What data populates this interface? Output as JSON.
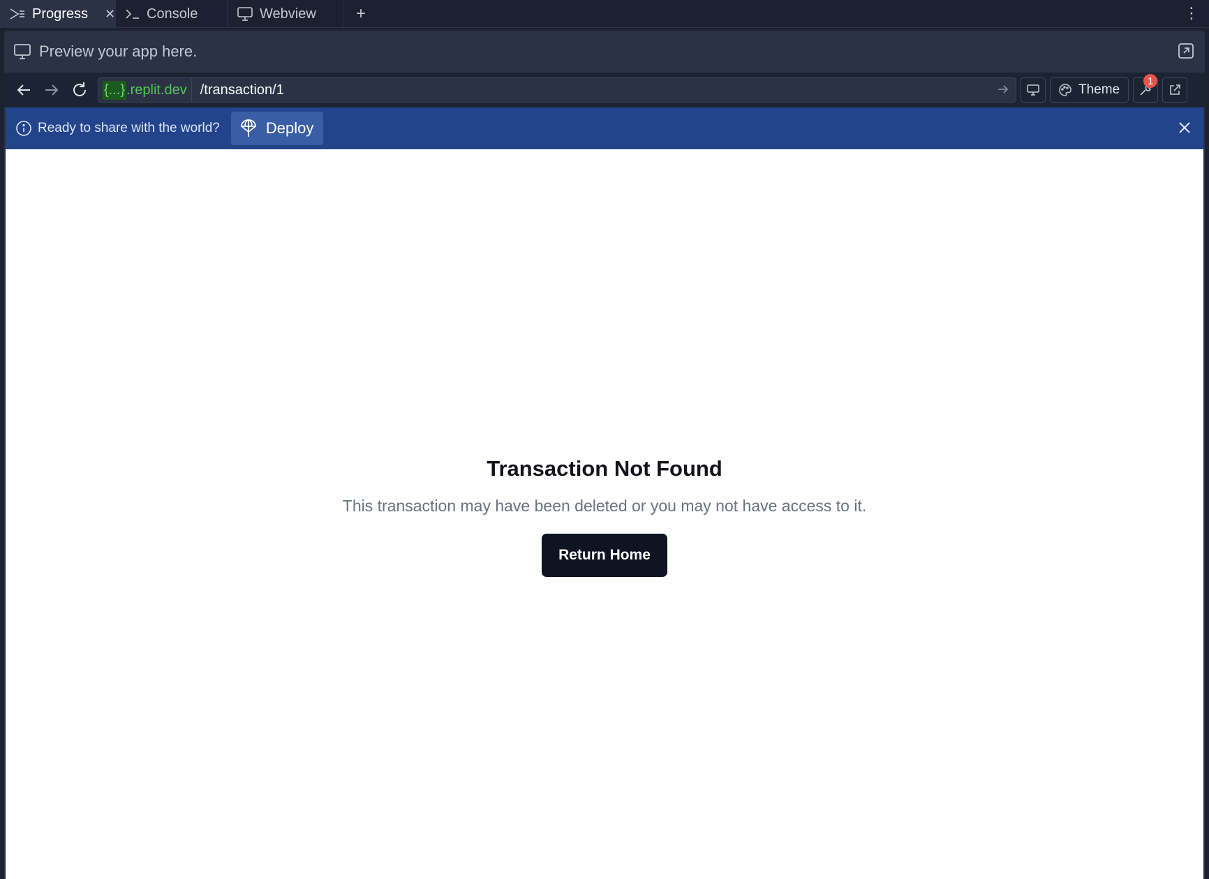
{
  "tabs": [
    {
      "label": "Progress",
      "icon": "progress-icon",
      "active": true
    },
    {
      "label": "Console",
      "icon": "terminal-icon",
      "active": false
    },
    {
      "label": "Webview",
      "icon": "monitor-icon",
      "active": false
    }
  ],
  "preview": {
    "text": "Preview your app here."
  },
  "urlbar": {
    "domain_masked": "{...}",
    "domain_suffix": ".replit.dev",
    "path": "/transaction/1",
    "theme_label": "Theme",
    "devtools_badge": "1"
  },
  "deploybar": {
    "message": "Ready to share with the world?",
    "deploy_label": "Deploy"
  },
  "page": {
    "title": "Transaction Not Found",
    "message": "This transaction may have been deleted or you may not have access to it.",
    "button_label": "Return Home"
  },
  "colors": {
    "deploy_banner": "#23448a",
    "domain_green": "#58c35a",
    "primary_button": "#0f1423",
    "badge_red": "#e5534b"
  }
}
